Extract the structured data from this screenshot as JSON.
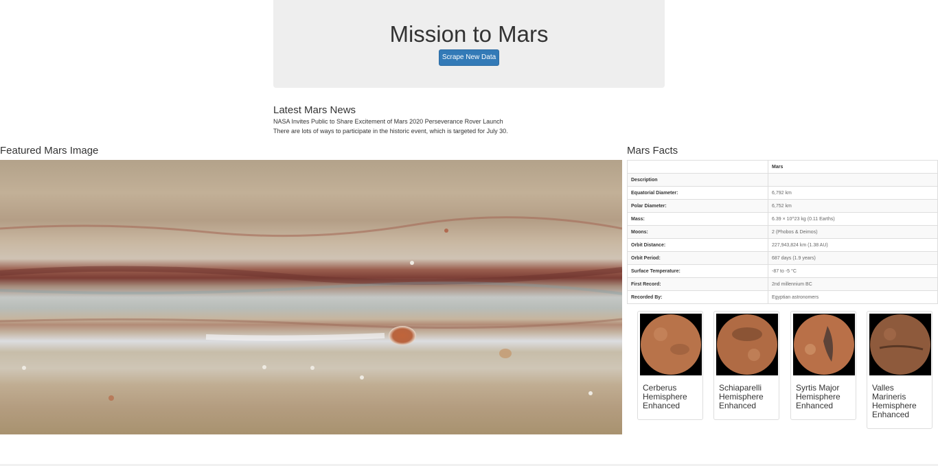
{
  "header": {
    "title": "Mission to Mars",
    "scrape_button": "Scrape New Data"
  },
  "news": {
    "heading": "Latest Mars News",
    "title": "NASA Invites Public to Share Excitement of Mars 2020 Perseverance Rover Launch",
    "teaser": "There are lots of ways to participate in the historic event, which is targeted for July 30."
  },
  "featured": {
    "heading": "Featured Mars Image"
  },
  "facts": {
    "heading": "Mars Facts",
    "column_header": "Mars",
    "rows": [
      {
        "label": "Description",
        "value": ""
      },
      {
        "label": "Equatorial Diameter:",
        "value": "6,792 km"
      },
      {
        "label": "Polar Diameter:",
        "value": "6,752 km"
      },
      {
        "label": "Mass:",
        "value": "6.39 × 10^23 kg (0.11 Earths)"
      },
      {
        "label": "Moons:",
        "value": "2 (Phobos & Deimos)"
      },
      {
        "label": "Orbit Distance:",
        "value": "227,943,824 km (1.38 AU)"
      },
      {
        "label": "Orbit Period:",
        "value": "687 days (1.9 years)"
      },
      {
        "label": "Surface Temperature:",
        "value": "-87 to -5 °C"
      },
      {
        "label": "First Record:",
        "value": "2nd millennium BC"
      },
      {
        "label": "Recorded By:",
        "value": "Egyptian astronomers"
      }
    ]
  },
  "hemispheres": [
    {
      "title": "Cerberus Hemisphere Enhanced",
      "color": "#b8734a"
    },
    {
      "title": "Schiaparelli Hemisphere Enhanced",
      "color": "#b06b44"
    },
    {
      "title": "Syrtis Major Hemisphere Enhanced",
      "color": "#b97048"
    },
    {
      "title": "Valles Marineris Hemisphere Enhanced",
      "color": "#8e5a3c"
    }
  ]
}
